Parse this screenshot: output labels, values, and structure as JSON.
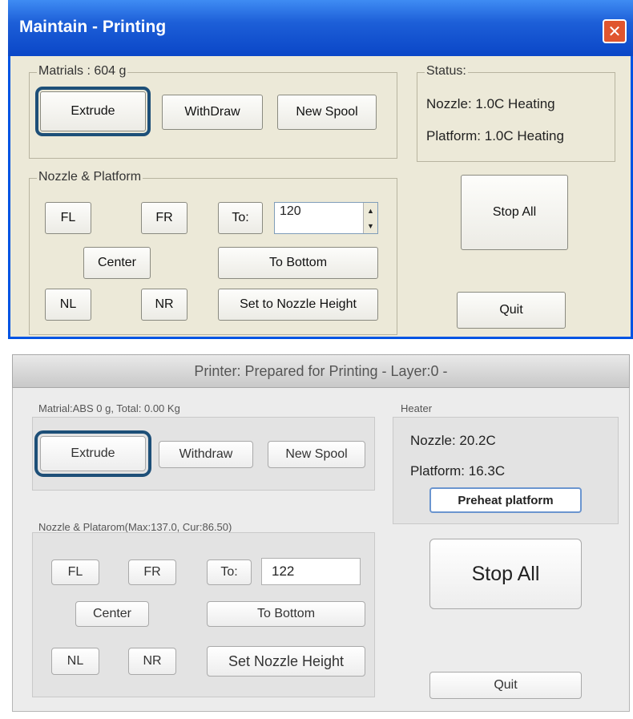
{
  "top_dialog": {
    "title": "Maintain - Printing",
    "close_label": "✕",
    "materials": {
      "label": "Matrials : 604 g",
      "extrude": "Extrude",
      "withdraw": "WithDraw",
      "new_spool": "New Spool"
    },
    "status": {
      "label": "Status:",
      "nozzle": "Nozzle: 1.0C Heating",
      "platform": "Platform: 1.0C Heating"
    },
    "nozzle_platform": {
      "label": "Nozzle & Platform",
      "fl": "FL",
      "fr": "FR",
      "to": "To:",
      "to_value": "120",
      "center": "Center",
      "to_bottom": "To Bottom",
      "nl": "NL",
      "nr": "NR",
      "set_nozzle": "Set to Nozzle Height"
    },
    "stop_all": "Stop All",
    "quit": "Quit"
  },
  "bottom_dialog": {
    "title": "Printer: Prepared for Printing - Layer:0 -",
    "material": {
      "label": "Matrial:ABS 0 g,  Total: 0.00 Kg",
      "extrude": "Extrude",
      "withdraw": "Withdraw",
      "new_spool": "New Spool"
    },
    "heater": {
      "label": "Heater",
      "nozzle": "Nozzle: 20.2C",
      "platform": "Platform: 16.3C",
      "preheat": "Preheat platform"
    },
    "nozzle_platform": {
      "label": "Nozzle & Platarom(Max:137.0, Cur:86.50)",
      "fl": "FL",
      "fr": "FR",
      "to": "To:",
      "to_value": "122",
      "center": "Center",
      "to_bottom": "To Bottom",
      "nl": "NL",
      "nr": "NR",
      "set_nozzle": "Set Nozzle  Height"
    },
    "stop_all": "Stop All",
    "quit": "Quit"
  },
  "colors": {
    "xp_titlebar": "#1d5fd8",
    "xp_face": "#ece9d8",
    "focus_ring": "#1d4f78",
    "mac_face": "#ececec"
  }
}
